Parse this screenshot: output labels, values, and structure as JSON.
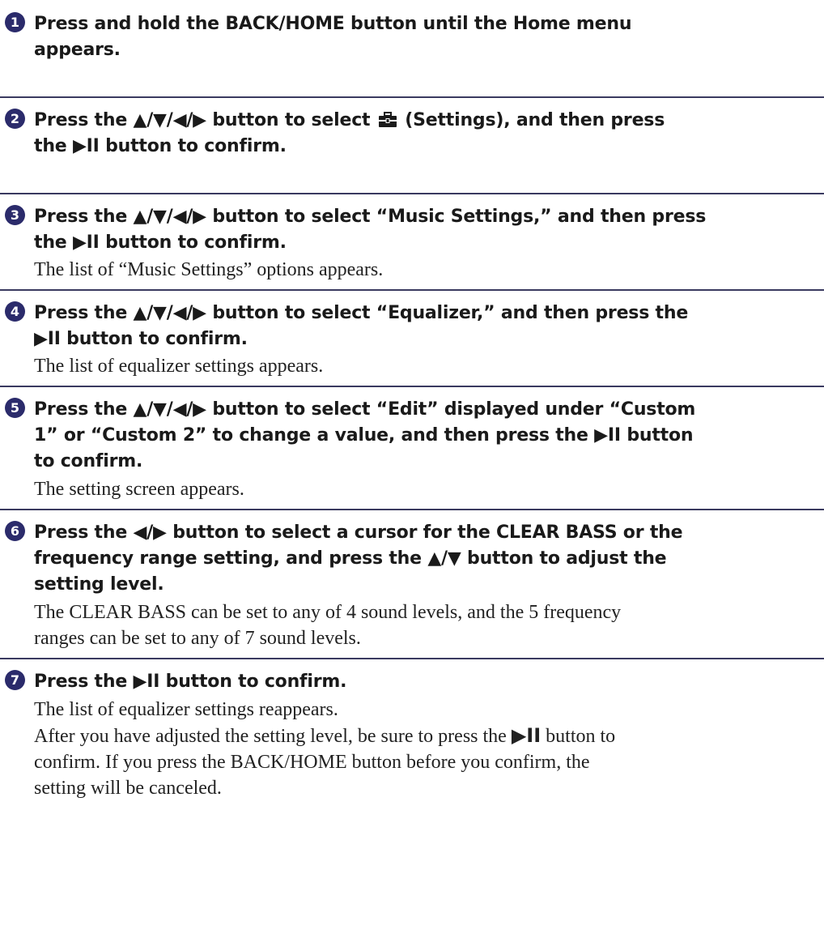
{
  "steps": [
    {
      "number": "1",
      "heading": [
        "Press and hold the BACK/HOME button until the Home menu",
        "appears."
      ],
      "body": []
    },
    {
      "number": "2",
      "heading_a": "Press the ▲/▼/◀/▶ button to select ",
      "settings_icon": "settings-toolbox-icon",
      "heading_b": " (Settings), and then press",
      "heading_line2": "the ▶II button to confirm.",
      "body": []
    },
    {
      "number": "3",
      "heading": [
        "Press the ▲/▼/◀/▶ button to select “Music Settings,” and then press",
        "the ▶II button to confirm."
      ],
      "body": [
        "The list of “Music Settings” options appears."
      ]
    },
    {
      "number": "4",
      "heading": [
        "Press the ▲/▼/◀/▶ button to select “Equalizer,” and then press the",
        "▶II button to confirm."
      ],
      "body": [
        "The list of equalizer settings appears."
      ]
    },
    {
      "number": "5",
      "heading": [
        "Press the ▲/▼/◀/▶ button to select “Edit” displayed under “Custom",
        "1” or “Custom 2” to change a value, and then press the ▶II button",
        "to confirm."
      ],
      "body": [
        "The setting screen appears."
      ]
    },
    {
      "number": "6",
      "heading": [
        "Press the ◀/▶ button to select a cursor for the CLEAR BASS or the",
        "frequency range setting, and press the ▲/▼ button to adjust the",
        "setting level."
      ],
      "body": [
        "The CLEAR BASS can be set to any of 4 sound levels, and the 5 frequency",
        "ranges can be set to any of 7 sound levels."
      ]
    },
    {
      "number": "7",
      "heading": [
        "Press the ▶II button to confirm."
      ],
      "body": [
        "The list of equalizer settings reappears."
      ],
      "note_a": "After you have adjusted the setting level, be sure to press the ",
      "note_glyph": "▶II",
      "note_b": " button to",
      "note_line2": "confirm. If you press the BACK/HOME button before you confirm, the",
      "note_line3": "setting will be canceled."
    }
  ],
  "colors": {
    "number_badge": "#2b2b6b",
    "rule": "#3a3a60"
  }
}
